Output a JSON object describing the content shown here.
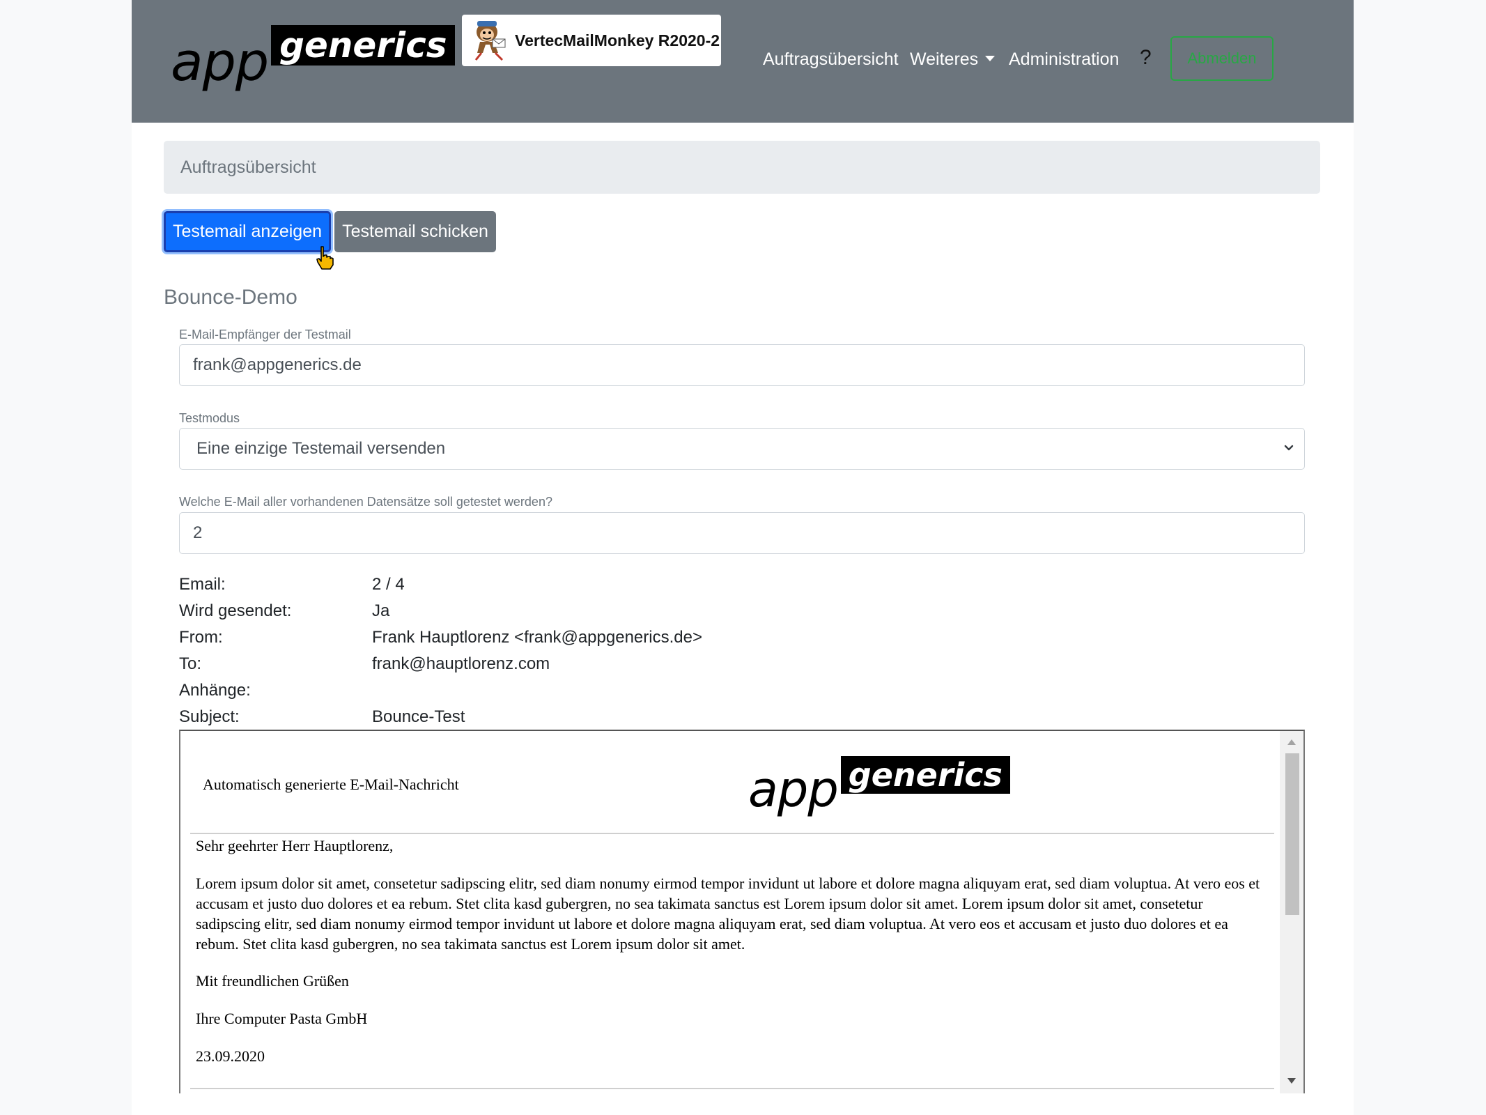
{
  "navbar": {
    "logo_app": "app",
    "logo_generics": "generics",
    "app_name": "VertecMailMonkey R2020-2",
    "links": [
      "Auftragsübersicht",
      "Weiteres",
      "Administration"
    ],
    "help": "?",
    "logout_label": "Abmelden"
  },
  "breadcrumb": "Auftragsübersicht",
  "buttons": {
    "show": "Testemail anzeigen",
    "send": "Testemail schicken"
  },
  "section_title": "Bounce-Demo",
  "form": {
    "recipient_label": "E-Mail-Empfänger der Testmail",
    "recipient_value": "frank@appgenerics.de",
    "mode_label": "Testmodus",
    "mode_value": "Eine einzige Testemail versenden",
    "record_label": "Welche E-Mail aller vorhandenen Datensätze soll getestet werden?",
    "record_value": "2"
  },
  "info": [
    {
      "key": "Email:",
      "value": "2 / 4"
    },
    {
      "key": "Wird gesendet:",
      "value": "Ja"
    },
    {
      "key": "From:",
      "value": "Frank Hauptlorenz <frank@appgenerics.de>"
    },
    {
      "key": "To:",
      "value": "frank@hauptlorenz.com"
    },
    {
      "key": "Anhänge:",
      "value": ""
    },
    {
      "key": "Subject:",
      "value": "Bounce-Test"
    }
  ],
  "mail": {
    "header_text": "Automatisch generierte E-Mail-Nachricht",
    "logo_app": "app",
    "logo_generics": "generics",
    "greeting": "Sehr geehrter Herr Hauptlorenz,",
    "body": "Lorem ipsum dolor sit amet, consetetur sadipscing elitr, sed diam nonumy eirmod tempor invidunt ut labore et dolore magna aliquyam erat, sed diam voluptua. At vero eos et accusam et justo duo dolores et ea rebum. Stet clita kasd gubergren, no sea takimata sanctus est Lorem ipsum dolor sit amet. Lorem ipsum dolor sit amet, consetetur sadipscing elitr, sed diam nonumy eirmod tempor invidunt ut labore et dolore magna aliquyam erat, sed diam voluptua. At vero eos et accusam et justo duo dolores et ea rebum. Stet clita kasd gubergren, no sea takimata sanctus est Lorem ipsum dolor sit amet.",
    "closing": "Mit freundlichen Grüßen",
    "company": "Ihre Computer Pasta GmbH",
    "date": "23.09.2020"
  },
  "colors": {
    "navbar": "#6c757d",
    "primary": "#0d6efd",
    "secondary": "#6c757d",
    "success": "#28a745"
  }
}
